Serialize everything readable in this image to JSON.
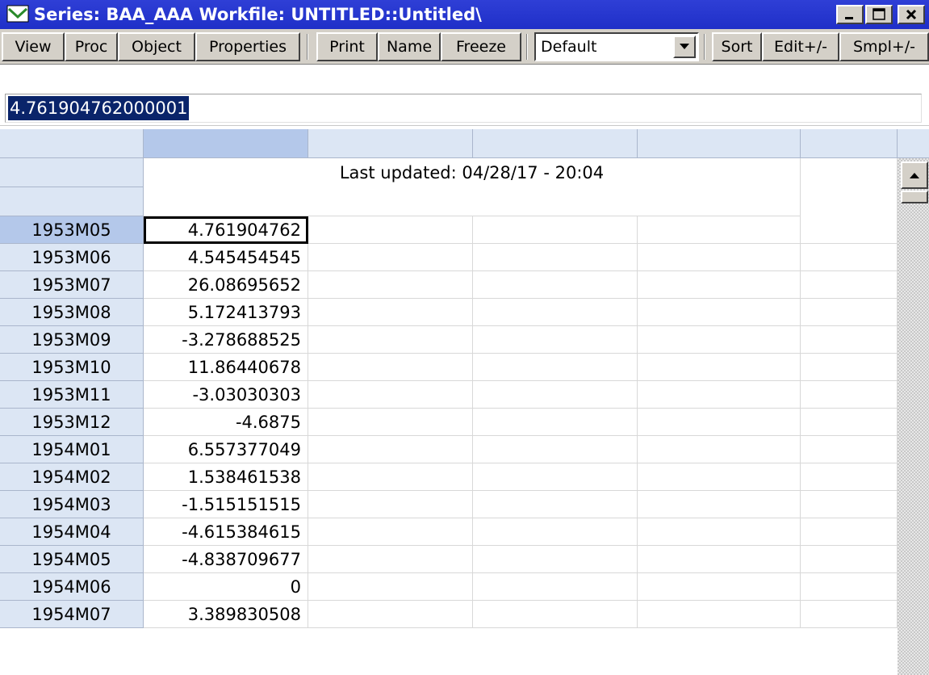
{
  "window": {
    "title": "Series: BAA_AAA   Workfile: UNTITLED::Untitled\\"
  },
  "toolbar": {
    "view": "View",
    "proc": "Proc",
    "object": "Object",
    "properties": "Properties",
    "print": "Print",
    "name": "Name",
    "freeze": "Freeze",
    "display_format": "Default",
    "sort": "Sort",
    "edit": "Edit+/-",
    "smpl": "Smpl+/-"
  },
  "edit_field": {
    "value": "4.761904762000001"
  },
  "grid": {
    "last_updated": "Last updated: 04/28/17 - 20:04",
    "rows": [
      {
        "date": "1953M05",
        "value": "4.761904762"
      },
      {
        "date": "1953M06",
        "value": "4.545454545"
      },
      {
        "date": "1953M07",
        "value": "26.08695652"
      },
      {
        "date": "1953M08",
        "value": "5.172413793"
      },
      {
        "date": "1953M09",
        "value": "-3.278688525"
      },
      {
        "date": "1953M10",
        "value": "11.86440678"
      },
      {
        "date": "1953M11",
        "value": "-3.03030303"
      },
      {
        "date": "1953M12",
        "value": "-4.6875"
      },
      {
        "date": "1954M01",
        "value": "6.557377049"
      },
      {
        "date": "1954M02",
        "value": "1.538461538"
      },
      {
        "date": "1954M03",
        "value": "-1.515151515"
      },
      {
        "date": "1954M04",
        "value": "-4.615384615"
      },
      {
        "date": "1954M05",
        "value": "-4.838709677"
      },
      {
        "date": "1954M06",
        "value": "0"
      },
      {
        "date": "1954M07",
        "value": "3.389830508"
      }
    ]
  },
  "icons": {
    "title": "series-icon",
    "minimize": "minimize-icon",
    "maximize": "maximize-icon",
    "close": "close-icon",
    "dropdown": "chevron-down-icon",
    "scroll_up": "scroll-up-icon"
  }
}
